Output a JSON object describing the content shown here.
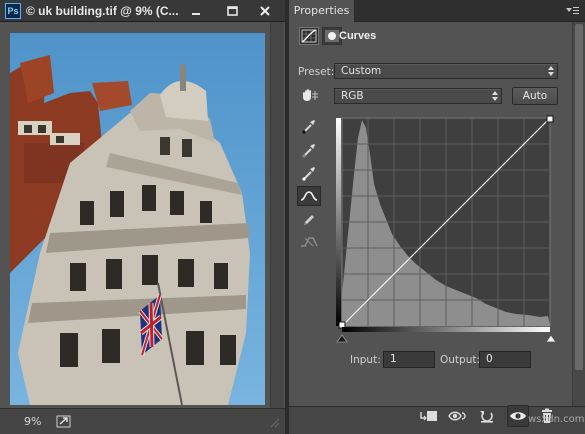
{
  "document": {
    "app_badge": "Ps",
    "title": "© uk building.tif @ 9% (C...",
    "zoom": "9%",
    "icons": [
      "minimize-icon",
      "maximize-icon",
      "close-icon",
      "export-arrow-icon"
    ]
  },
  "panel": {
    "tab_label": "Properties",
    "adjustment_title": "Curves",
    "preset_label": "Preset:",
    "preset_value": "Custom",
    "channel_value": "RGB",
    "auto_label": "Auto",
    "input_label": "Input:",
    "input_value": "1",
    "output_label": "Output:",
    "output_value": "0",
    "tools": [
      "sample-black-point-eyedropper-icon",
      "sample-gray-point-eyedropper-icon",
      "sample-white-point-eyedropper-icon",
      "edit-points-curve-icon",
      "draw-pencil-icon",
      "smooth-curve-icon"
    ],
    "footer_icons": [
      "clip-to-layer-icon",
      "view-previous-state-icon",
      "reset-icon",
      "toggle-visibility-icon",
      "delete-icon"
    ]
  },
  "watermark": "wsxdn.com",
  "colors": {
    "panel_bg": "#535353",
    "graph_bg": "#3f3f3f",
    "histogram": "#8e8e8e",
    "curve": "#f2f2f2",
    "sky": "#5fa0d0"
  }
}
